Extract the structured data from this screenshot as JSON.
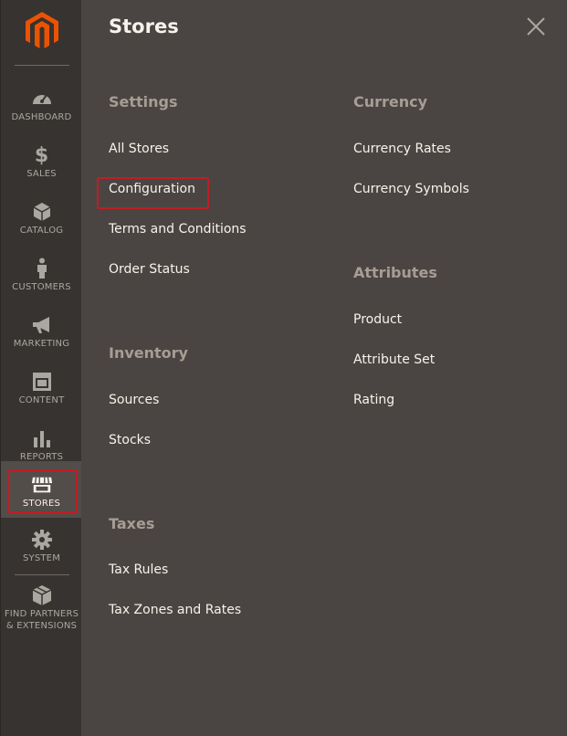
{
  "sidebar": {
    "logo": "magento-logo",
    "items": [
      {
        "label": "DASHBOARD",
        "icon": "dashboard-icon"
      },
      {
        "label": "SALES",
        "icon": "dollar-icon"
      },
      {
        "label": "CATALOG",
        "icon": "cube-icon"
      },
      {
        "label": "CUSTOMERS",
        "icon": "person-icon"
      },
      {
        "label": "MARKETING",
        "icon": "megaphone-icon"
      },
      {
        "label": "CONTENT",
        "icon": "layout-icon"
      },
      {
        "label": "REPORTS",
        "icon": "bar-chart-icon"
      },
      {
        "label": "STORES",
        "icon": "storefront-icon",
        "active": true
      },
      {
        "label": "SYSTEM",
        "icon": "gear-icon"
      },
      {
        "label": "FIND PARTNERS & EXTENSIONS",
        "icon": "boxes-icon"
      }
    ]
  },
  "panel": {
    "title": "Stores",
    "close_icon": "close-icon",
    "sections": {
      "settings": {
        "title": "Settings",
        "links": [
          "All Stores",
          "Configuration",
          "Terms and Conditions",
          "Order Status"
        ]
      },
      "inventory": {
        "title": "Inventory",
        "links": [
          "Sources",
          "Stocks"
        ]
      },
      "taxes": {
        "title": "Taxes",
        "links": [
          "Tax Rules",
          "Tax Zones and Rates"
        ]
      },
      "currency": {
        "title": "Currency",
        "links": [
          "Currency Rates",
          "Currency Symbols"
        ]
      },
      "attributes": {
        "title": "Attributes",
        "links": [
          "Product",
          "Attribute Set",
          "Rating"
        ]
      }
    }
  },
  "colors": {
    "accent_highlight": "#c01d25",
    "logo_orange": "#eb5202",
    "panel_bg": "#4a4542",
    "sidebar_bg": "#373330"
  }
}
